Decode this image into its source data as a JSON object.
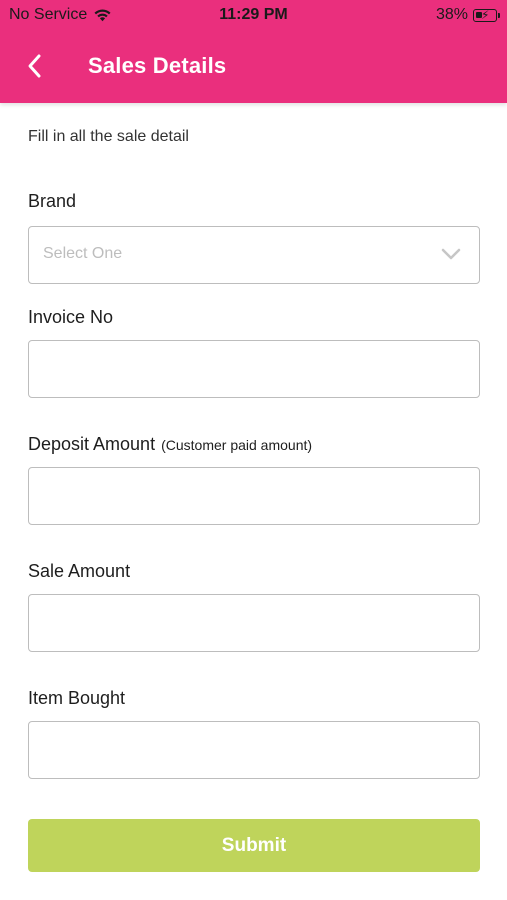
{
  "status_bar": {
    "carrier": "No Service",
    "time": "11:29 PM",
    "battery": "38%"
  },
  "header": {
    "title": "Sales Details",
    "back_icon": "chevron-left-icon"
  },
  "form": {
    "intro": "Fill in all the sale detail",
    "brand": {
      "label": "Brand",
      "placeholder": "Select One"
    },
    "invoice": {
      "label": "Invoice No",
      "value": ""
    },
    "deposit": {
      "label": "Deposit Amount",
      "sublabel": "(Customer paid amount)",
      "value": ""
    },
    "sale_amount": {
      "label": "Sale Amount",
      "value": ""
    },
    "item_bought": {
      "label": "Item Bought",
      "value": ""
    },
    "submit_label": "Submit"
  },
  "colors": {
    "header": "#ea2f7d",
    "submit": "#bfd45b",
    "field_border": "#bdbdbd"
  }
}
